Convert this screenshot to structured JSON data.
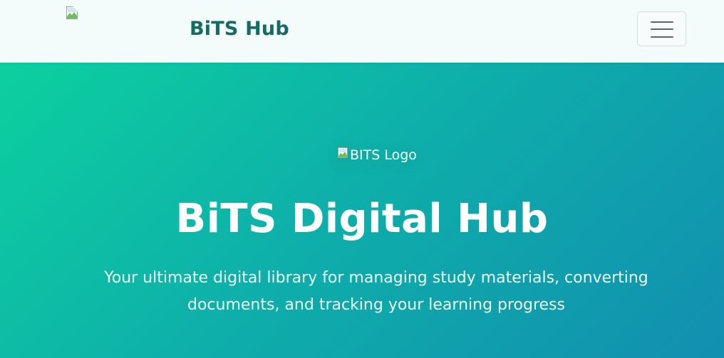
{
  "navbar": {
    "logo_icon": "broken-image-icon",
    "brand_name": "BiTS Hub",
    "menu_icon": "hamburger-menu-icon"
  },
  "hero": {
    "logo_alt": "BITS Logo",
    "title": "BiTS Digital Hub",
    "subtitle": "Your ultimate digital library for managing study materials, converting documents, and tracking your learning progress"
  },
  "colors": {
    "brand_text": "#136b63",
    "navbar_bg": "#f4fbfb",
    "hero_gradient_start": "#0cd09f",
    "hero_gradient_end": "#128fb0",
    "hero_text": "#ffffff"
  }
}
